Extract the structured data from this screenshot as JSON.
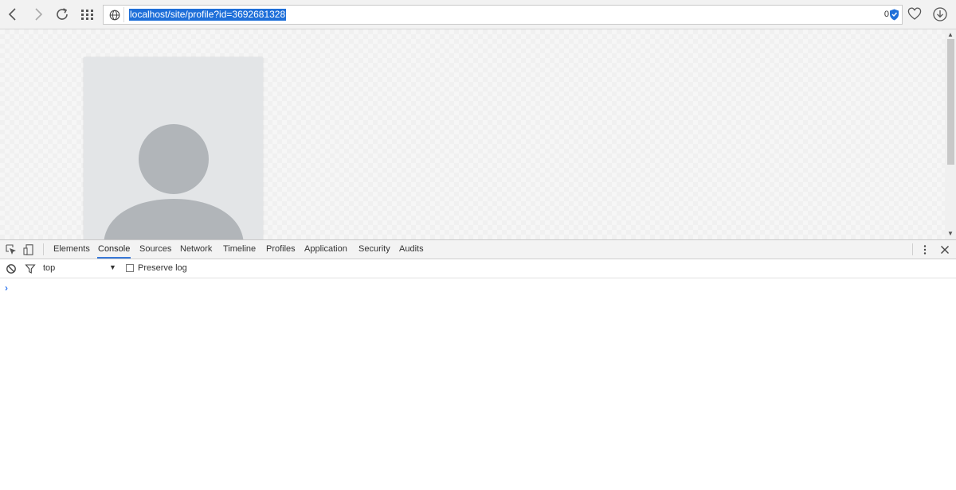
{
  "browser": {
    "url": "localhost/site/profile?id=3692681328",
    "adblock_count": "0"
  },
  "colors": {
    "url_selection": "#1e6fd9",
    "active_tab_underline": "#3879d9",
    "console_prompt": "#367cf1",
    "avatar_bg": "#e3e5e7",
    "avatar_figure": "#b1b5b9"
  },
  "page": {
    "avatar_icon": "person-placeholder-icon"
  },
  "devtools": {
    "tabs": [
      {
        "label": "Elements",
        "active": false
      },
      {
        "label": "Console",
        "active": true
      },
      {
        "label": "Sources",
        "active": false
      },
      {
        "label": "Network",
        "active": false
      },
      {
        "label": "Timeline",
        "active": false
      },
      {
        "label": "Profiles",
        "active": false
      },
      {
        "label": "Application",
        "active": false
      },
      {
        "label": "Security",
        "active": false
      },
      {
        "label": "Audits",
        "active": false
      }
    ],
    "console": {
      "context": "top",
      "context_arrow": "▼",
      "preserve_log_label": "Preserve log",
      "preserve_log_checked": false,
      "prompt": "›"
    }
  }
}
